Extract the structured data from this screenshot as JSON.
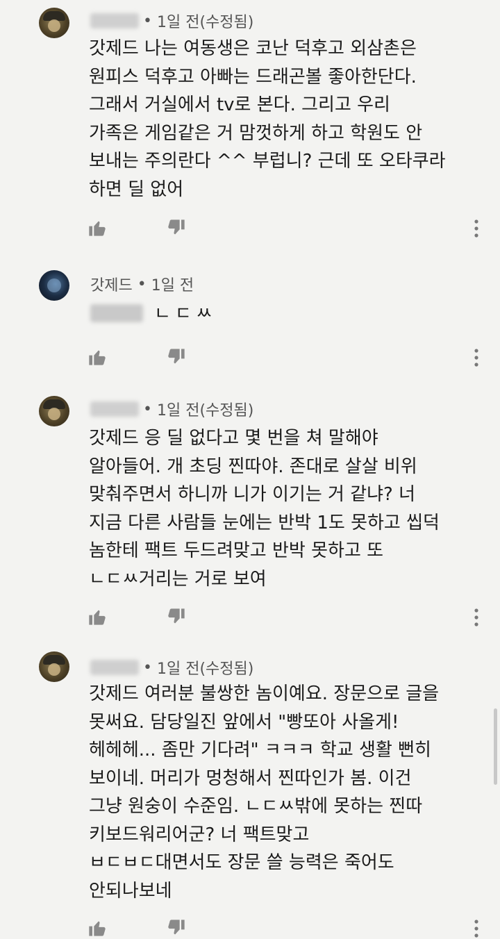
{
  "comments": [
    {
      "author": "",
      "time": "1일 전(수정됨)",
      "text": "갓제드 나는 여동생은 코난 덕후고 외삼촌은\n원피스 덕후고 아빠는 드래곤볼 좋아한단다.\n그래서 거실에서 tv로 본다. 그리고 우리\n가족은 게임같은 거 맘껏하게 하고 학원도 안\n보내는 주의란다 ^^ 부럽니? 근데 또 오타쿠라\n하면 딜 없어"
    },
    {
      "author": "갓제드",
      "time": "1일 전",
      "text": "ㄴㄷㅆ"
    },
    {
      "author": "",
      "time": "1일 전(수정됨)",
      "text": "갓제드 응 딜 없다고 몇 번을 쳐 말해야\n알아들어. 개 초딩 찐따야. 존대로 살살 비위\n맞춰주면서 하니까 니가 이기는 거 같냐? 너\n지금 다른 사람들 눈에는 반박 1도 못하고 씹덕\n놈한테 팩트 두드려맞고 반박 못하고 또\nㄴㄷㅆ거리는 거로 보여"
    },
    {
      "author": "",
      "time": "1일 전(수정됨)",
      "text": "갓제드 여러분 불쌍한 놈이예요. 장문으로 글을\n못써요. 담당일진 앞에서 \"빵또아 사올게!\n헤헤헤... 좀만 기다려\" ㅋㅋㅋ 학교 생활 뻔히\n보이네. 머리가 멍청해서 찐따인가 봄. 이건\n그냥 원숭이 수준임. ㄴㄷㅆ밖에 못하는 찐따\n키보드워리어군? 너 팩트맞고\nㅂㄷㅂㄷ대면서도 장문 쓸 능력은 죽어도\n안되나보네"
    }
  ],
  "icons": {
    "like": "thumb-up-icon",
    "dislike": "thumb-down-icon",
    "more": "more-vert-icon"
  },
  "colors": {
    "background": "#f3f3f1",
    "text": "#1b1b1b",
    "meta": "#555555",
    "icon": "#8a8a8a"
  }
}
